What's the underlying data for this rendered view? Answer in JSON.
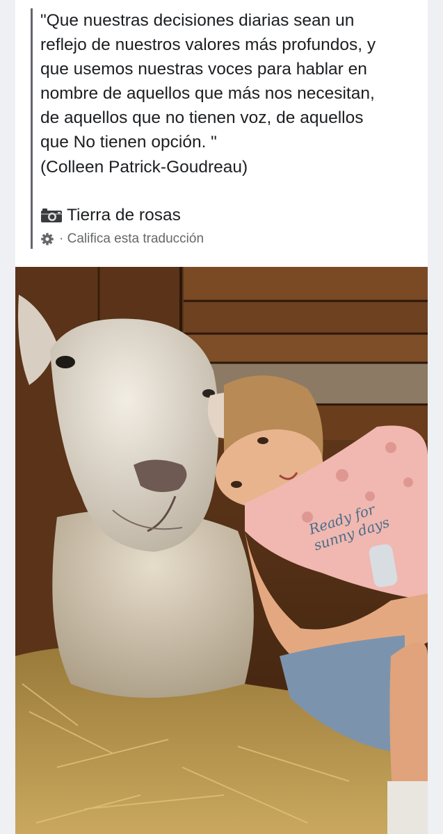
{
  "post": {
    "quote_lines": [
      "\"Que nuestras decisiones diarias sean un",
      "reflejo de nuestros valores más profundos, y",
      "que usemos nuestras voces para hablar en",
      "nombre de aquellos que más nos necesitan,",
      "de aquellos que no tienen voz, de aquellos",
      "que No tienen opción. \""
    ],
    "author": "(Colleen Patrick-Goudreau)",
    "credit_icon": "camera-icon",
    "credit": "Tierra de rosas",
    "translate_icon": "gear-icon",
    "translate_label": "· Califica esta traducción"
  },
  "photo": {
    "text_on_shirt": [
      "Ready for",
      "sunny days"
    ]
  },
  "colors": {
    "text": "#1c1e21",
    "secondary": "#65676b",
    "quote_bar": "#606770",
    "background": "#eef0f3"
  }
}
